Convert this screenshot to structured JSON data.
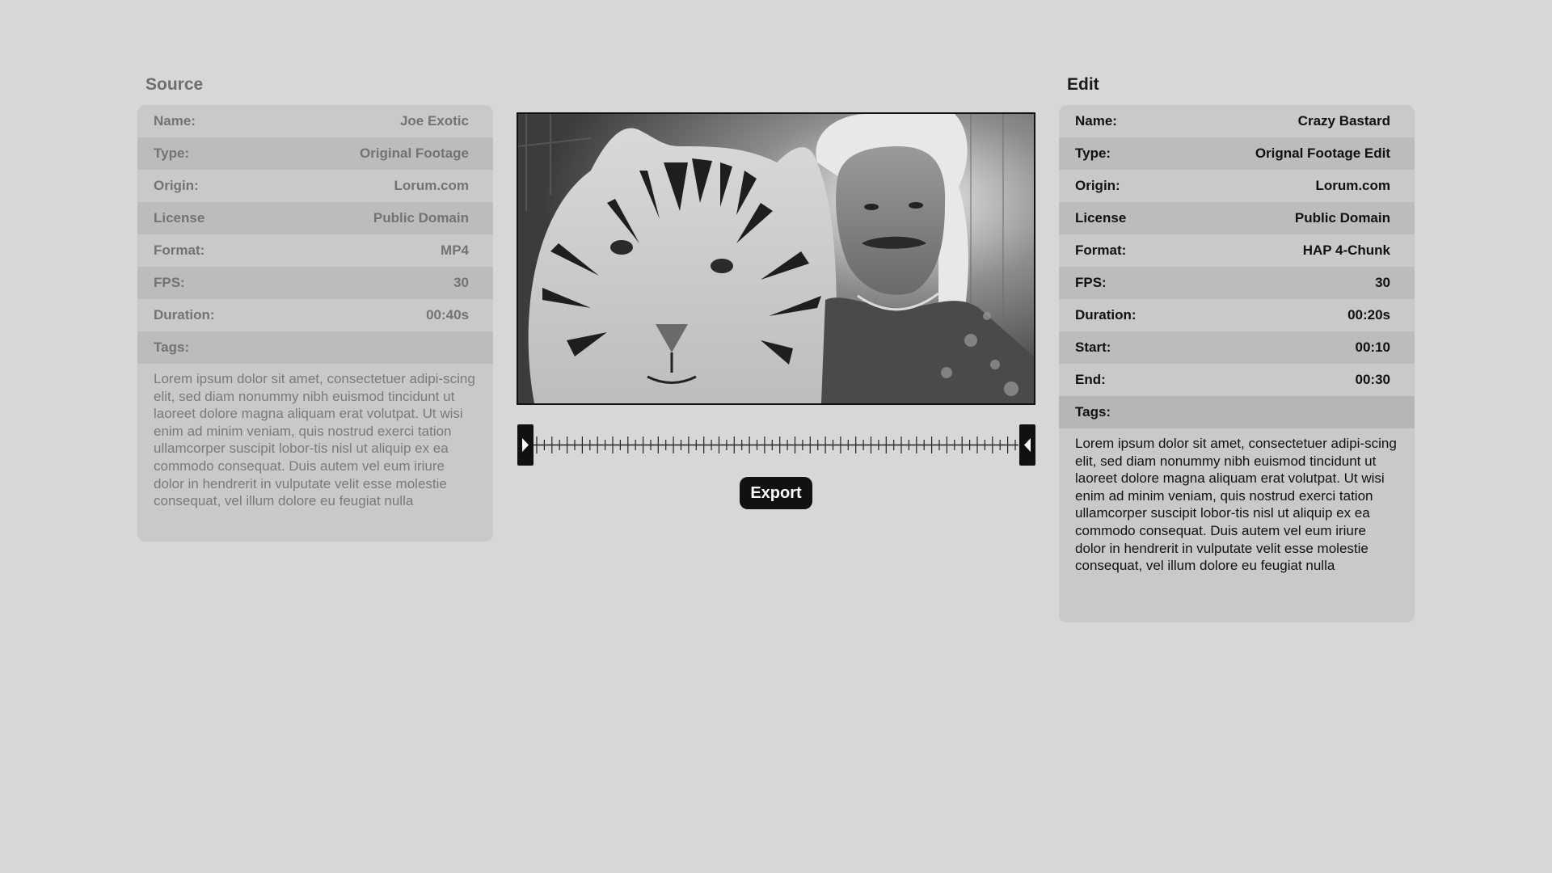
{
  "source": {
    "title": "Source",
    "rows": [
      {
        "label": "Name:",
        "value": "Joe Exotic"
      },
      {
        "label": "Type:",
        "value": "Original Footage"
      },
      {
        "label": "Origin:",
        "value": "Lorum.com"
      },
      {
        "label": "License",
        "value": "Public Domain"
      },
      {
        "label": "Format:",
        "value": "MP4"
      },
      {
        "label": "FPS:",
        "value": "30"
      },
      {
        "label": "Duration:",
        "value": "00:40s"
      }
    ],
    "tags_label": "Tags:",
    "tags_text": "Lorem ipsum dolor sit amet, consectetuer adipi-scing elit, sed diam nonummy nibh euismod tincidunt ut laoreet dolore magna aliquam erat volutpat. Ut wisi enim ad minim veniam, quis nostrud exerci tation ullamcorper suscipit lobor-tis nisl ut aliquip ex ea commodo consequat. Duis autem vel eum iriure dolor in hendrerit in vulputate velit esse molestie consequat, vel illum dolore eu feugiat nulla"
  },
  "edit": {
    "title": "Edit",
    "rows": [
      {
        "label": "Name:",
        "value": "Crazy Bastard"
      },
      {
        "label": "Type:",
        "value": "Orignal Footage Edit"
      },
      {
        "label": "Origin:",
        "value": "Lorum.com"
      },
      {
        "label": "License",
        "value": "Public Domain"
      },
      {
        "label": "Format:",
        "value": "HAP 4-Chunk"
      },
      {
        "label": "FPS:",
        "value": "30"
      },
      {
        "label": "Duration:",
        "value": "00:20s"
      },
      {
        "label": "Start:",
        "value": "00:10"
      },
      {
        "label": "End:",
        "value": "00:30"
      }
    ],
    "tags_label": "Tags:",
    "tags_text": "Lorem ipsum dolor sit amet, consectetuer adipi-scing elit, sed diam nonummy nibh euismod tincidunt ut laoreet dolore magna aliquam erat volutpat. Ut wisi enim ad minim veniam, quis nostrud exerci tation ullamcorper suscipit lobor-tis nisl ut aliquip ex ea commodo consequat. Duis autem vel eum iriure dolor in hendrerit in vulputate velit esse molestie consequat, vel illum dolore eu feugiat nulla"
  },
  "preview": {
    "image_description_icon": "video-frame-icon"
  },
  "timeline": {
    "tick_count": 64,
    "trim_start_icon": "trim-start-handle-icon",
    "trim_end_icon": "trim-end-handle-icon"
  },
  "actions": {
    "export_label": "Export"
  },
  "colors": {
    "background": "#d7d7d7",
    "panel": "#c9c9c9",
    "panel_alt_row": "#bcbcbc",
    "source_text": "#737373",
    "edit_text": "#111111",
    "button": "#111111"
  }
}
